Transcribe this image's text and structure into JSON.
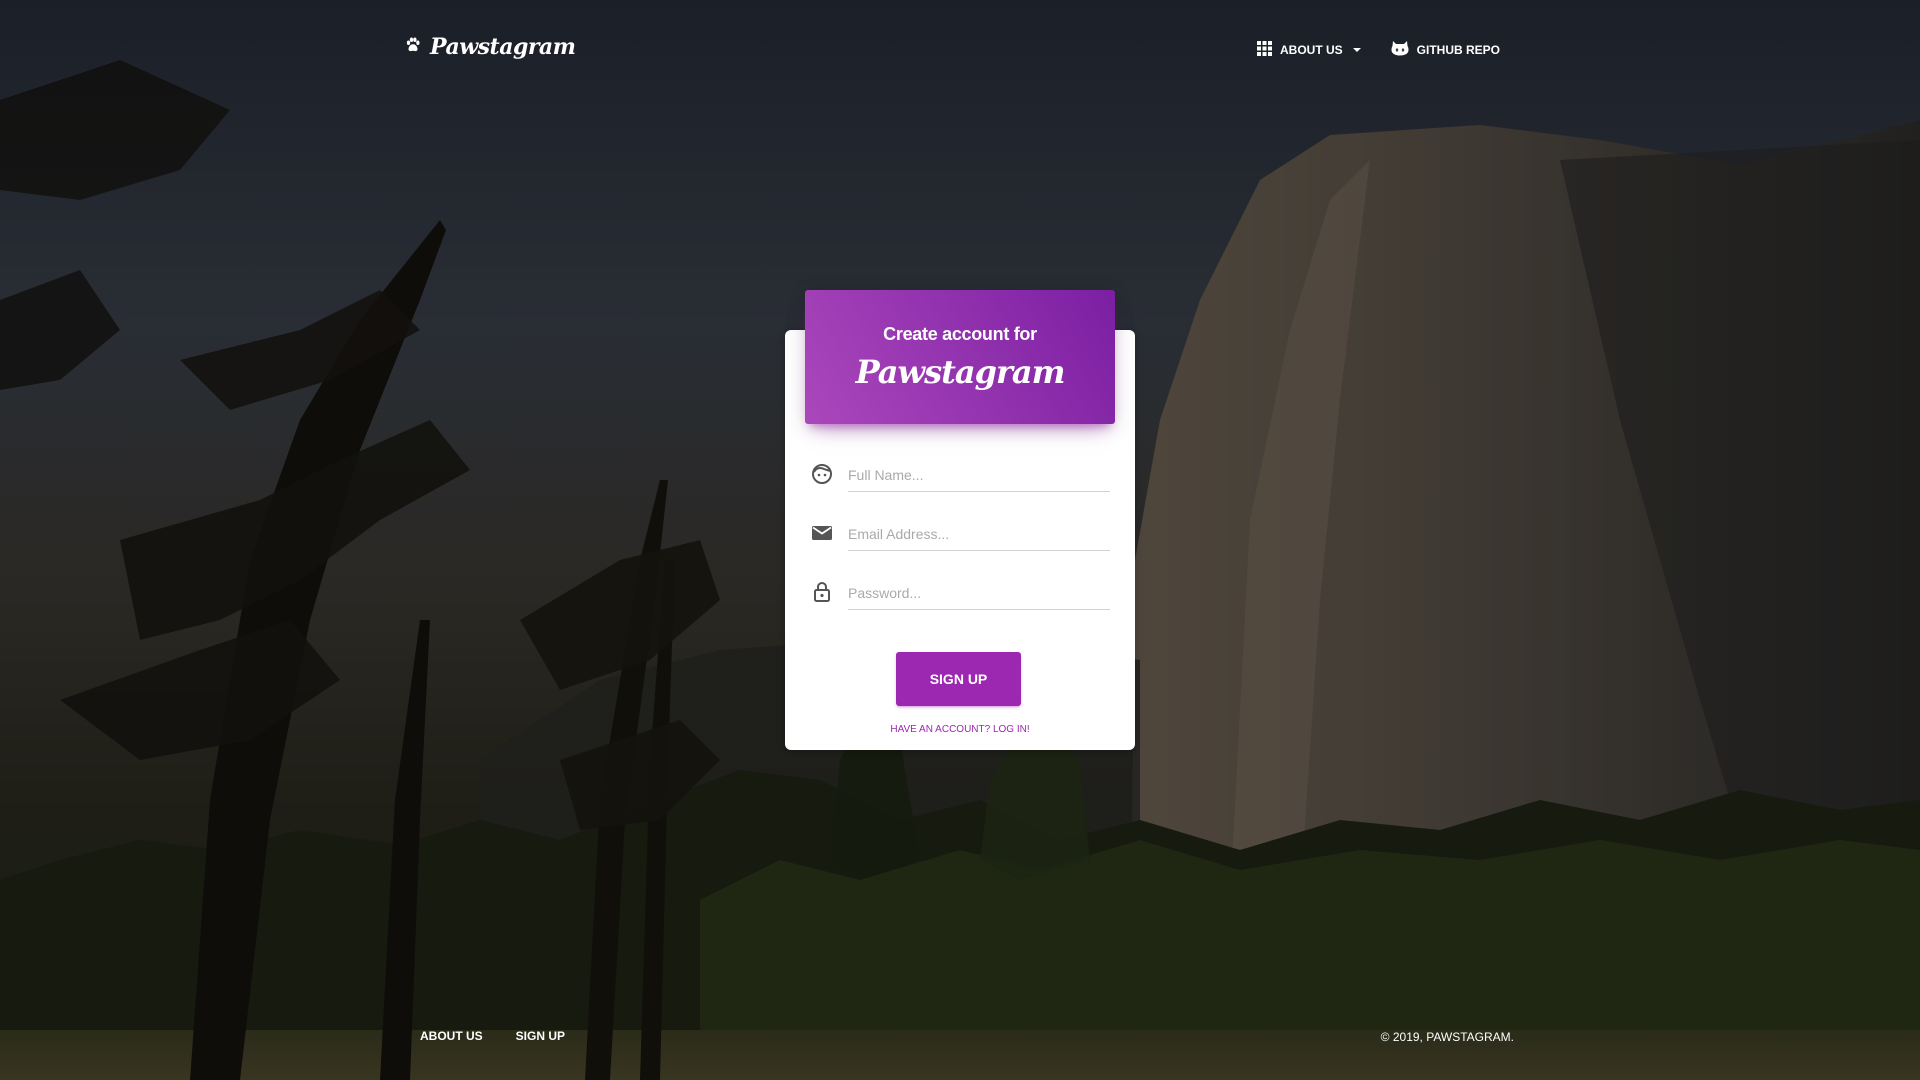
{
  "navbar": {
    "brand": "Pawstagram",
    "links": [
      {
        "label": "About us",
        "icon": "apps-grid-icon",
        "has_dropdown": true
      },
      {
        "label": "GitHub Repo",
        "icon": "github-icon",
        "has_dropdown": false
      }
    ]
  },
  "card": {
    "title": "Create account for",
    "brand": "Pawstagram",
    "fields": {
      "full_name": {
        "placeholder": "Full Name...",
        "value": "",
        "icon": "face-icon"
      },
      "email": {
        "placeholder": "Email Address...",
        "value": "",
        "icon": "mail-icon"
      },
      "password": {
        "placeholder": "Password...",
        "value": "",
        "icon": "lock-icon"
      }
    },
    "submit_label": "Sign up",
    "login_link": "Have an account? Log in!"
  },
  "footer": {
    "links": [
      "About us",
      "Sign up"
    ],
    "copyright": "© 2019, PAWSTAGRAM."
  },
  "colors": {
    "accent": "#9c27b0",
    "header_gradient_start": "#ab47bc",
    "header_gradient_end": "#7b1fa2"
  }
}
